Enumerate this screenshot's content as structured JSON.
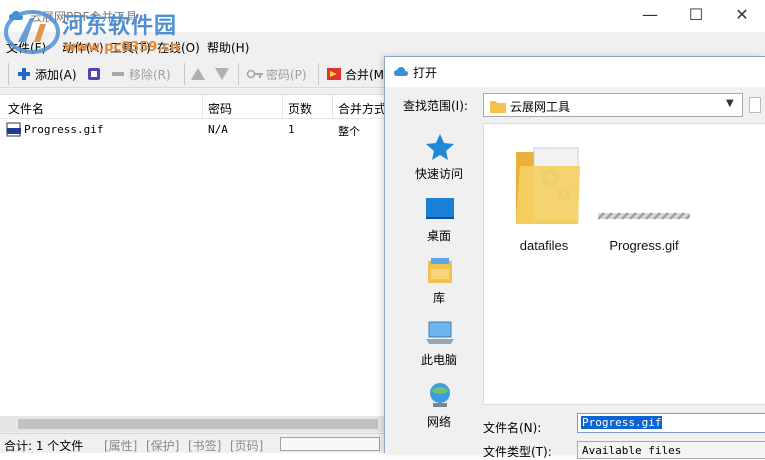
{
  "app": {
    "title": "云展网PDF合并工具",
    "window_controls": {
      "minimize": "—",
      "maximize": "☐",
      "close": "✕"
    }
  },
  "watermark": {
    "text": "河东软件园",
    "url": "www.pc0359.cn"
  },
  "menu": [
    {
      "label": "文件(F)"
    },
    {
      "label": "动作(A)"
    },
    {
      "label": "工具(T)"
    },
    {
      "label": "在线(O)"
    },
    {
      "label": "帮助(H)"
    }
  ],
  "toolbar": {
    "add": "添加(A)",
    "remove": "移除(R)",
    "password": "密码(P)",
    "merge": "合并(M)"
  },
  "list": {
    "columns": [
      "文件名",
      "密码",
      "页数",
      "合并方式"
    ],
    "rows": [
      {
        "file": "Progress.gif",
        "password": "N/A",
        "pages": "1",
        "mode": "整个"
      }
    ]
  },
  "statusbar": {
    "total": "合计: 1 个文件",
    "properties": "[属性]",
    "protect": "[保护]",
    "bookmarks": "[书签]",
    "pages": "[页码]"
  },
  "dialog": {
    "title": "打开",
    "look_in_label": "查找范围(I):",
    "look_in_value": "云展网工具",
    "places": [
      {
        "label": "快速访问",
        "icon": "star-icon"
      },
      {
        "label": "桌面",
        "icon": "desktop-icon"
      },
      {
        "label": "库",
        "icon": "library-icon"
      },
      {
        "label": "此电脑",
        "icon": "computer-icon"
      },
      {
        "label": "网络",
        "icon": "network-icon"
      }
    ],
    "files": [
      {
        "name": "datafiles",
        "type": "folder"
      },
      {
        "name": "Progress.gif",
        "type": "gif"
      }
    ],
    "file_name_label": "文件名(N):",
    "file_name_value": "Progress.gif",
    "file_type_label": "文件类型(T):",
    "file_type_value": "Available files"
  },
  "colors": {
    "accent": "#0a64d4",
    "watermark_blue": "#4e8fd3",
    "watermark_orange": "#e28a3a",
    "folder_yellow": "#f2c24c"
  }
}
